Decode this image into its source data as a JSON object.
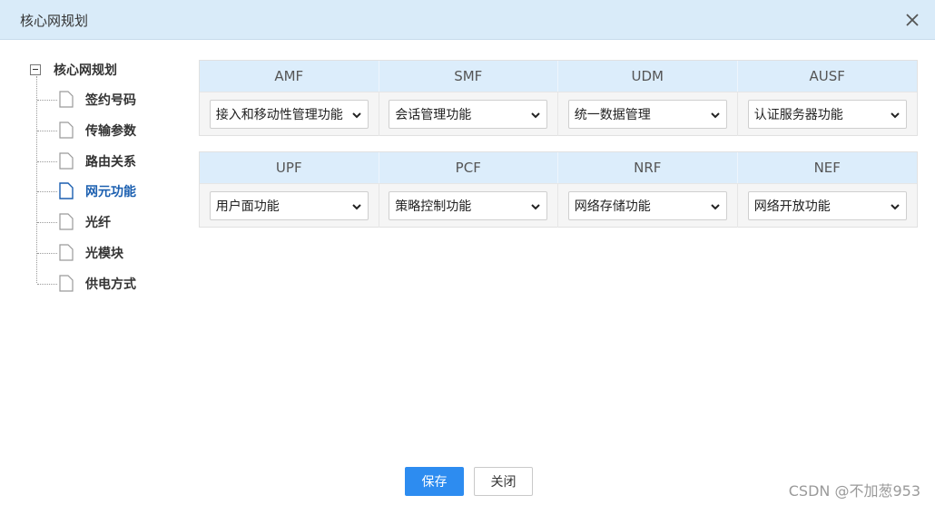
{
  "dialog": {
    "title": "核心网规划",
    "close_icon": "close-icon"
  },
  "tree": {
    "root_label": "核心网规划",
    "items": [
      {
        "label": "签约号码",
        "active": false
      },
      {
        "label": "传输参数",
        "active": false
      },
      {
        "label": "路由关系",
        "active": false
      },
      {
        "label": "网元功能",
        "active": true
      },
      {
        "label": "光纤",
        "active": false
      },
      {
        "label": "光模块",
        "active": false
      },
      {
        "label": "供电方式",
        "active": false
      }
    ]
  },
  "grid1": {
    "headers": [
      "AMF",
      "SMF",
      "UDM",
      "AUSF"
    ],
    "values": [
      "接入和移动性管理功能",
      "会话管理功能",
      "统一数据管理",
      "认证服务器功能"
    ]
  },
  "grid2": {
    "headers": [
      "UPF",
      "PCF",
      "NRF",
      "NEF"
    ],
    "values": [
      "用户面功能",
      "策略控制功能",
      "网络存储功能",
      "网络开放功能"
    ]
  },
  "footer": {
    "save_label": "保存",
    "close_label": "关闭"
  },
  "watermark": "CSDN @不加葱953",
  "colors": {
    "header_bg": "#d9ebf9",
    "grid_header_bg": "#dcedfb",
    "accent": "#2d8cf0",
    "active_text": "#1b5fb0"
  }
}
